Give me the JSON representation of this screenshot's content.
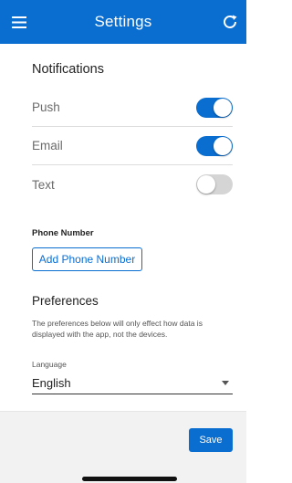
{
  "header": {
    "title": "Settings",
    "background_color": "#0a6ed1",
    "menu_icon": "hamburger-menu-icon",
    "refresh_icon": "refresh-icon"
  },
  "notifications": {
    "title": "Notifications",
    "rows": [
      {
        "label": "Push",
        "enabled": true
      },
      {
        "label": "Email",
        "enabled": true
      },
      {
        "label": "Text",
        "enabled": false
      }
    ]
  },
  "phone": {
    "label": "Phone Number",
    "add_button_label": "Add Phone Number"
  },
  "preferences": {
    "title": "Preferences",
    "description": "The preferences below will only effect how data is displayed with the app, not the devices.",
    "language_label": "Language",
    "language_value": "English"
  },
  "footer": {
    "save_label": "Save"
  },
  "colors": {
    "accent": "#0a6ed1",
    "toggle_off": "#d5d5d5",
    "footer_bg": "#f2f2f2"
  }
}
